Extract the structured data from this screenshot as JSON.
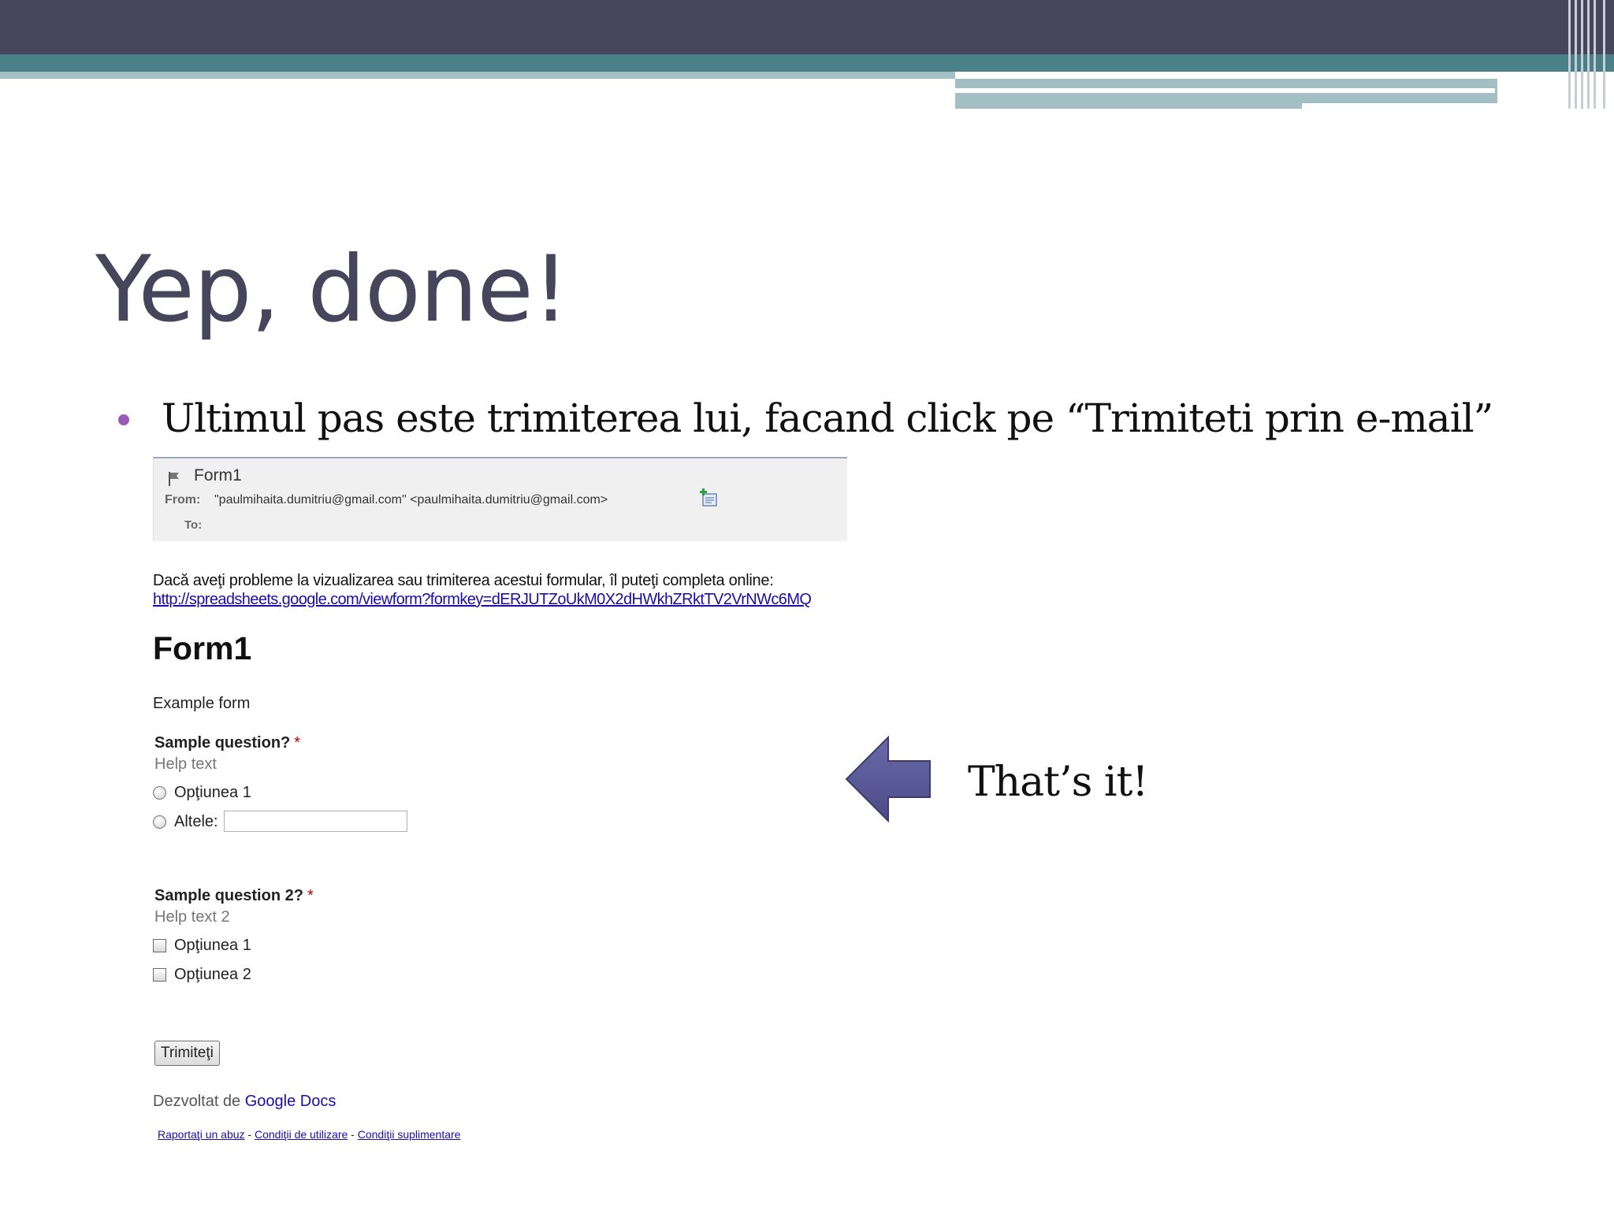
{
  "slide": {
    "title": "Yep, done!",
    "bullet": "Ultimul pas este trimiterea lui, facand click pe “Trimiteti prin e-mail”",
    "callout": "That’s it!"
  },
  "colors": {
    "header_dark": "#46455c",
    "header_teal": "#4a8188",
    "header_light": "#a3bfc4",
    "bullet": "#9b59b6",
    "arrow": "#5a5a96",
    "link": "#1a0dab"
  },
  "email": {
    "subject": "Form1",
    "from_label": "From:",
    "from_value": "\"paulmihaita.dumitriu@gmail.com\" <paulmihaita.dumitriu@gmail.com>",
    "to_label": "To:"
  },
  "form": {
    "notice": "Dacă aveţi probleme la vizualizarea sau trimiterea acestui formular, îl puteţi completa online:",
    "link": "http://spreadsheets.google.com/viewform?formkey=dERJUTZoUkM0X2dHWkhZRktTV2VrNWc6MQ",
    "title": "Form1",
    "description": "Example form",
    "questions": [
      {
        "label": "Sample question?",
        "required_mark": "*",
        "help": "Help text",
        "options": [
          "Opţiunea 1",
          "Altele:"
        ]
      },
      {
        "label": "Sample question 2?",
        "required_mark": "*",
        "help": "Help text 2",
        "options": [
          "Opţiunea 1",
          "Opţiunea 2"
        ]
      }
    ],
    "submit_label": "Trimiteţi",
    "footer": {
      "prefix": "Dezvoltat de",
      "brand": "Google Docs",
      "links": [
        "Raportaţi un abuz",
        "Condiţii de utilizare",
        "Condiţii suplimentare"
      ],
      "separator": "-"
    }
  }
}
